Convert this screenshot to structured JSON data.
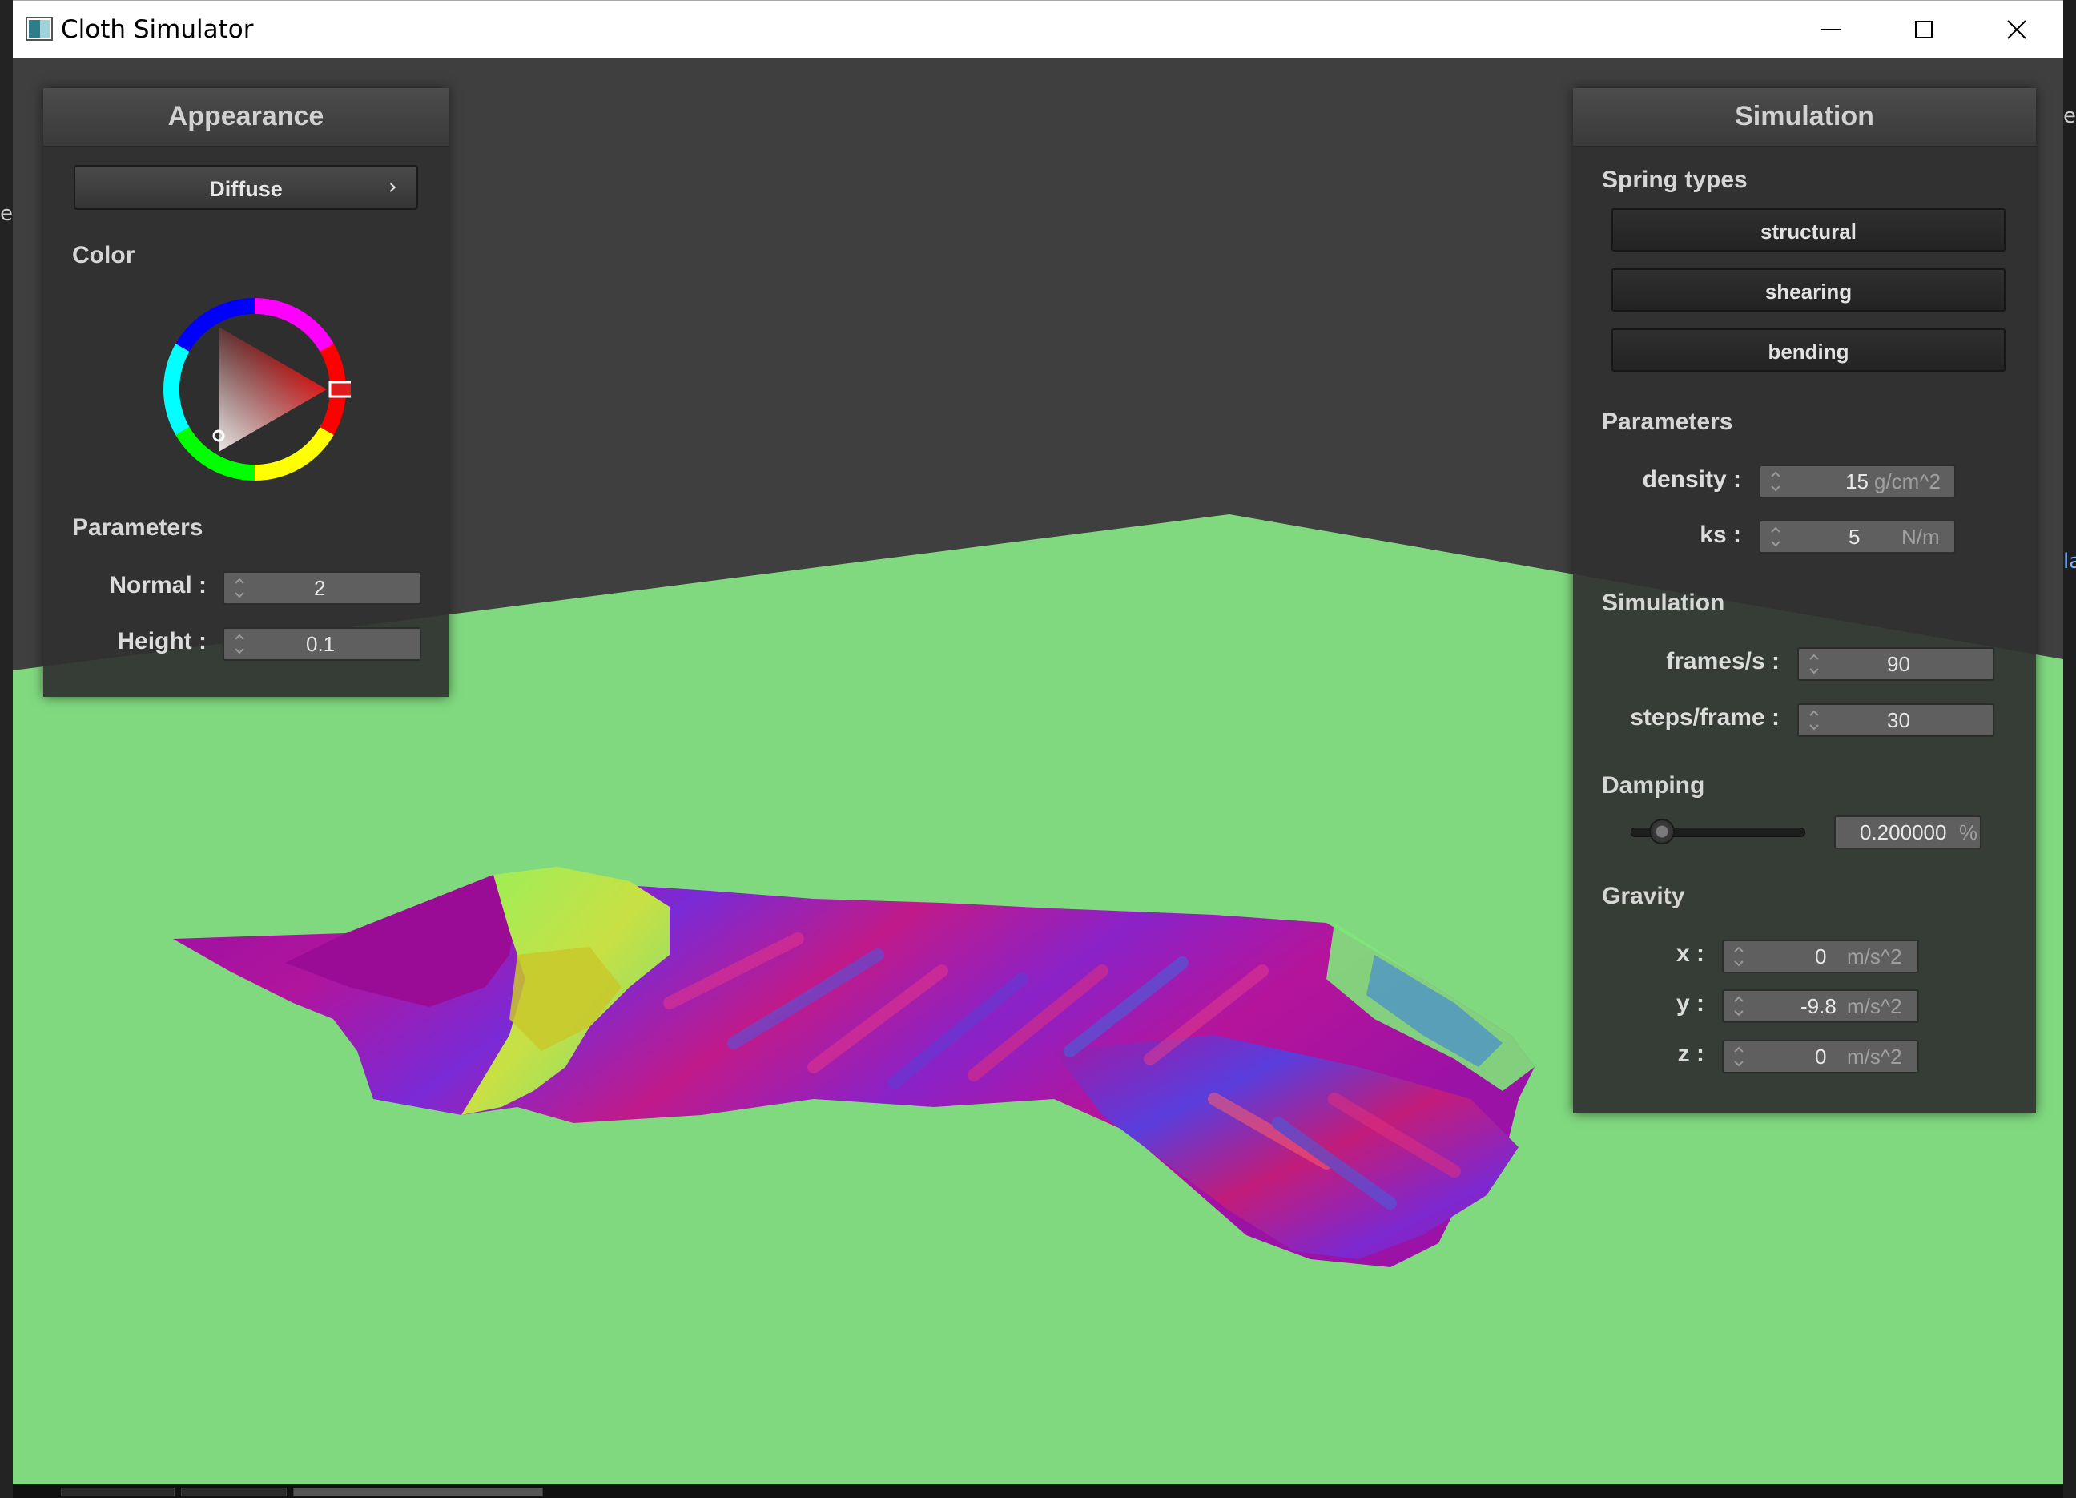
{
  "window": {
    "title": "Cloth Simulator"
  },
  "desktop": {
    "left_glyph": "e",
    "right_glyph_1": "e",
    "right_glyph_2": "la"
  },
  "appearance": {
    "title": "Appearance",
    "shader": "Diffuse",
    "shader_chevron": "›",
    "color_label": "Color",
    "selected_color": "#e01b1b",
    "parameters_label": "Parameters",
    "normal_label": "Normal :",
    "normal_value": "2",
    "height_label": "Height :",
    "height_value": "0.1"
  },
  "simulation": {
    "title": "Simulation",
    "spring_types_label": "Spring types",
    "spring_types": [
      "structural",
      "shearing",
      "bending"
    ],
    "parameters_label": "Parameters",
    "density_label": "density :",
    "density_value": "15",
    "density_unit": "g/cm^2",
    "ks_label": "ks :",
    "ks_value": "5",
    "ks_unit": "N/m",
    "simulation_label": "Simulation",
    "fps_label": "frames/s :",
    "fps_value": "90",
    "steps_label": "steps/frame :",
    "steps_value": "30",
    "damping_label": "Damping",
    "damping_value": "0.200000",
    "damping_unit": "%",
    "damping_slider_fraction": 0.2,
    "gravity_label": "Gravity",
    "gx_label": "x :",
    "gx_value": "0",
    "gy_label": "y :",
    "gy_value": "-9.8",
    "gz_label": "z :",
    "gz_value": "0",
    "gravity_unit": "m/s^2"
  },
  "colors": {
    "floor": "#80d97f",
    "background": "#3f3f3f",
    "cloth_main": "#9b14a8"
  }
}
